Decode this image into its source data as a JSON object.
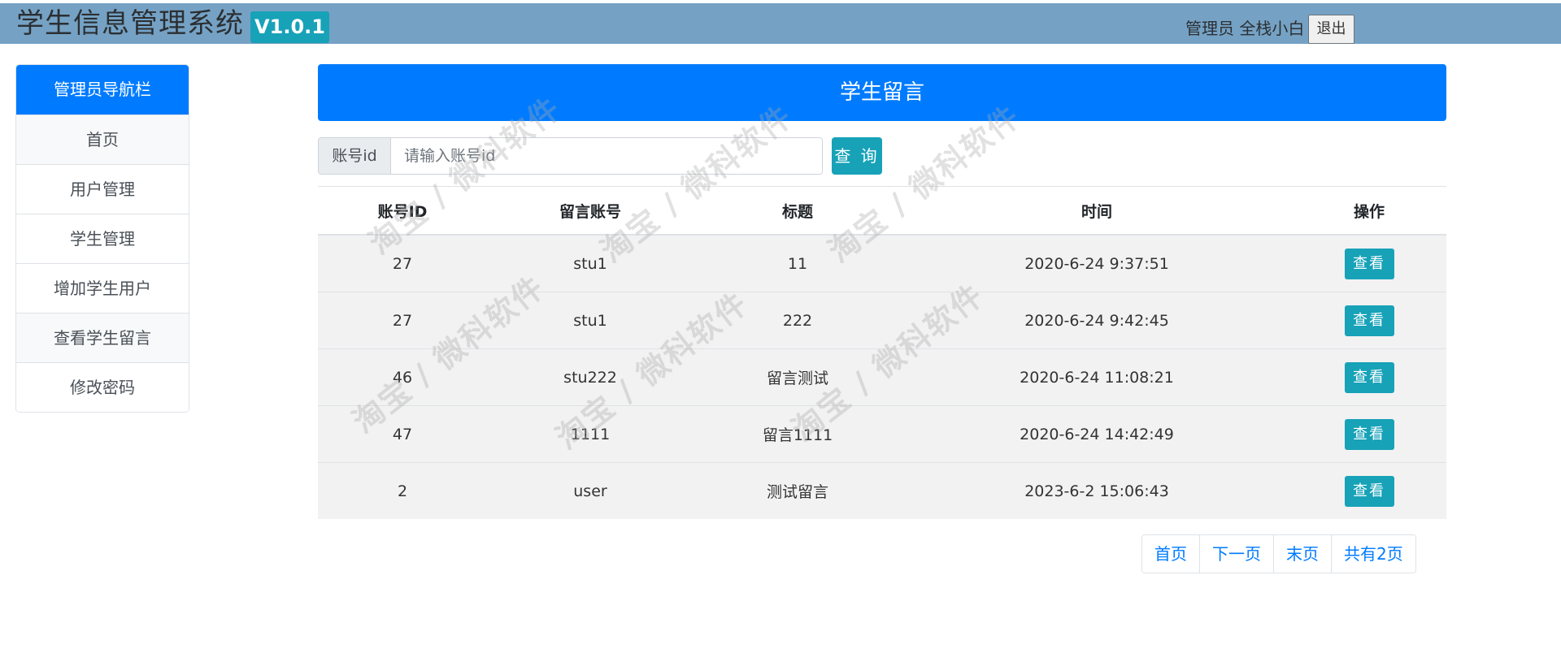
{
  "header": {
    "title": "学生信息管理系统",
    "version": "V1.0.1",
    "user_info": "管理员 全栈小白",
    "logout_label": "退出",
    "background_color": "#75a2c4"
  },
  "sidebar": {
    "title": "管理员导航栏",
    "items": [
      {
        "label": "首页"
      },
      {
        "label": "用户管理"
      },
      {
        "label": "学生管理"
      },
      {
        "label": "增加学生用户"
      },
      {
        "label": "查看学生留言"
      },
      {
        "label": "修改密码"
      }
    ]
  },
  "main": {
    "panel_title": "学生留言",
    "search": {
      "label": "账号id",
      "placeholder": "请输入账号id",
      "button_label": "查 询"
    },
    "table": {
      "headers": [
        "账号ID",
        "留言账号",
        "标题",
        "时间",
        "操作"
      ],
      "rows": [
        {
          "id": "27",
          "account": "stu1",
          "title": "11",
          "time": "2020-6-24 9:37:51",
          "action": "查看"
        },
        {
          "id": "27",
          "account": "stu1",
          "title": "222",
          "time": "2020-6-24 9:42:45",
          "action": "查看"
        },
        {
          "id": "46",
          "account": "stu222",
          "title": "留言测试",
          "time": "2020-6-24 11:08:21",
          "action": "查看"
        },
        {
          "id": "47",
          "account": "1111",
          "title": "留言1111",
          "time": "2020-6-24 14:42:49",
          "action": "查看"
        },
        {
          "id": "2",
          "account": "user",
          "title": "测试留言",
          "time": "2023-6-2 15:06:43",
          "action": "查看"
        }
      ]
    },
    "pagination": {
      "first": "首页",
      "next": "下一页",
      "last": "末页",
      "total": "共有2页"
    }
  },
  "watermark_text": "淘宝 / 微科软件",
  "colors": {
    "primary": "#007bff",
    "info": "#17a2b8",
    "row_background": "#f2f2f2"
  }
}
